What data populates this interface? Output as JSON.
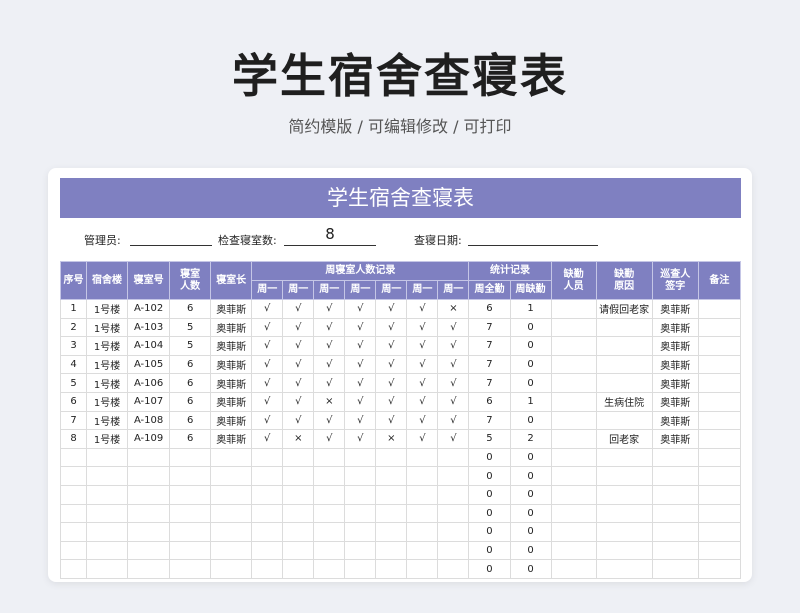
{
  "page": {
    "title": "学生宿舍查寝表",
    "subtitle": "简约模版 / 可编辑修改 / 可打印"
  },
  "sheet": {
    "banner": "学生宿舍查寝表",
    "meta": {
      "manager_label": "管理员:",
      "manager_value": "",
      "count_label": "检查寝室数:",
      "count_value": "8",
      "date_label": "查寝日期:",
      "date_value": ""
    },
    "headers": {
      "seq": "序号",
      "building": "宿舍楼",
      "room": "寝室号",
      "occupants": "寝室人数",
      "leader": "寝室长",
      "weekly_group": "周寝室人数记录",
      "days": [
        "周一",
        "周一",
        "周一",
        "周一",
        "周一",
        "周一",
        "周一"
      ],
      "stats_group": "统计记录",
      "full_attend": "周全勤",
      "absent_count": "周缺勤",
      "absentees": "缺勤人员",
      "reason": "缺勤原因",
      "inspector": "巡查人签字",
      "remark": "备注"
    },
    "rows": [
      {
        "seq": "1",
        "building": "1号楼",
        "room": "A-102",
        "occupants": "6",
        "leader": "奥菲斯",
        "days": [
          "√",
          "√",
          "√",
          "√",
          "√",
          "√",
          "×"
        ],
        "full": "6",
        "absent": "1",
        "absentees": "",
        "reason": "请假回老家",
        "inspector": "奥菲斯",
        "remark": ""
      },
      {
        "seq": "2",
        "building": "1号楼",
        "room": "A-103",
        "occupants": "5",
        "leader": "奥菲斯",
        "days": [
          "√",
          "√",
          "√",
          "√",
          "√",
          "√",
          "√"
        ],
        "full": "7",
        "absent": "0",
        "absentees": "",
        "reason": "",
        "inspector": "奥菲斯",
        "remark": ""
      },
      {
        "seq": "3",
        "building": "1号楼",
        "room": "A-104",
        "occupants": "5",
        "leader": "奥菲斯",
        "days": [
          "√",
          "√",
          "√",
          "√",
          "√",
          "√",
          "√"
        ],
        "full": "7",
        "absent": "0",
        "absentees": "",
        "reason": "",
        "inspector": "奥菲斯",
        "remark": ""
      },
      {
        "seq": "4",
        "building": "1号楼",
        "room": "A-105",
        "occupants": "6",
        "leader": "奥菲斯",
        "days": [
          "√",
          "√",
          "√",
          "√",
          "√",
          "√",
          "√"
        ],
        "full": "7",
        "absent": "0",
        "absentees": "",
        "reason": "",
        "inspector": "奥菲斯",
        "remark": ""
      },
      {
        "seq": "5",
        "building": "1号楼",
        "room": "A-106",
        "occupants": "6",
        "leader": "奥菲斯",
        "days": [
          "√",
          "√",
          "√",
          "√",
          "√",
          "√",
          "√"
        ],
        "full": "7",
        "absent": "0",
        "absentees": "",
        "reason": "",
        "inspector": "奥菲斯",
        "remark": ""
      },
      {
        "seq": "6",
        "building": "1号楼",
        "room": "A-107",
        "occupants": "6",
        "leader": "奥菲斯",
        "days": [
          "√",
          "√",
          "×",
          "√",
          "√",
          "√",
          "√"
        ],
        "full": "6",
        "absent": "1",
        "absentees": "",
        "reason": "生病住院",
        "inspector": "奥菲斯",
        "remark": ""
      },
      {
        "seq": "7",
        "building": "1号楼",
        "room": "A-108",
        "occupants": "6",
        "leader": "奥菲斯",
        "days": [
          "√",
          "√",
          "√",
          "√",
          "√",
          "√",
          "√"
        ],
        "full": "7",
        "absent": "0",
        "absentees": "",
        "reason": "",
        "inspector": "奥菲斯",
        "remark": ""
      },
      {
        "seq": "8",
        "building": "1号楼",
        "room": "A-109",
        "occupants": "6",
        "leader": "奥菲斯",
        "days": [
          "√",
          "×",
          "√",
          "√",
          "×",
          "√",
          "√"
        ],
        "full": "5",
        "absent": "2",
        "absentees": "",
        "reason": "回老家",
        "inspector": "奥菲斯",
        "remark": ""
      },
      {
        "seq": "",
        "building": "",
        "room": "",
        "occupants": "",
        "leader": "",
        "days": [
          "",
          "",
          "",
          "",
          "",
          "",
          ""
        ],
        "full": "0",
        "absent": "0",
        "absentees": "",
        "reason": "",
        "inspector": "",
        "remark": ""
      },
      {
        "seq": "",
        "building": "",
        "room": "",
        "occupants": "",
        "leader": "",
        "days": [
          "",
          "",
          "",
          "",
          "",
          "",
          ""
        ],
        "full": "0",
        "absent": "0",
        "absentees": "",
        "reason": "",
        "inspector": "",
        "remark": ""
      },
      {
        "seq": "",
        "building": "",
        "room": "",
        "occupants": "",
        "leader": "",
        "days": [
          "",
          "",
          "",
          "",
          "",
          "",
          ""
        ],
        "full": "0",
        "absent": "0",
        "absentees": "",
        "reason": "",
        "inspector": "",
        "remark": ""
      },
      {
        "seq": "",
        "building": "",
        "room": "",
        "occupants": "",
        "leader": "",
        "days": [
          "",
          "",
          "",
          "",
          "",
          "",
          ""
        ],
        "full": "0",
        "absent": "0",
        "absentees": "",
        "reason": "",
        "inspector": "",
        "remark": ""
      },
      {
        "seq": "",
        "building": "",
        "room": "",
        "occupants": "",
        "leader": "",
        "days": [
          "",
          "",
          "",
          "",
          "",
          "",
          ""
        ],
        "full": "0",
        "absent": "0",
        "absentees": "",
        "reason": "",
        "inspector": "",
        "remark": ""
      },
      {
        "seq": "",
        "building": "",
        "room": "",
        "occupants": "",
        "leader": "",
        "days": [
          "",
          "",
          "",
          "",
          "",
          "",
          ""
        ],
        "full": "0",
        "absent": "0",
        "absentees": "",
        "reason": "",
        "inspector": "",
        "remark": ""
      },
      {
        "seq": "",
        "building": "",
        "room": "",
        "occupants": "",
        "leader": "",
        "days": [
          "",
          "",
          "",
          "",
          "",
          "",
          ""
        ],
        "full": "0",
        "absent": "0",
        "absentees": "",
        "reason": "",
        "inspector": "",
        "remark": ""
      }
    ]
  }
}
